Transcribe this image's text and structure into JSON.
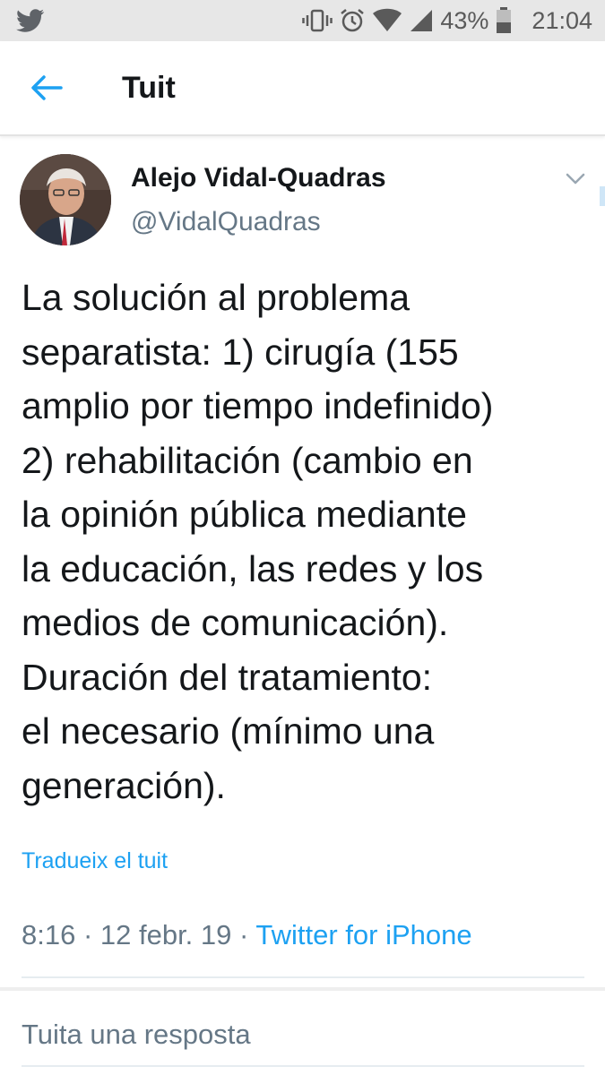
{
  "status_bar": {
    "battery_percent": "43%",
    "time": "21:04",
    "icons": [
      "twitter-bird-icon",
      "vibrate-icon",
      "alarm-icon",
      "wifi-icon",
      "cell-signal-icon",
      "battery-icon"
    ]
  },
  "app_bar": {
    "title": "Tuit",
    "back_icon": "arrow-left-icon"
  },
  "tweet": {
    "author_name": "Alejo Vidal-Quadras",
    "author_handle": "@VidalQuadras",
    "text_lines": [
      "La solución al problema",
      "separatista: 1) cirugía (155",
      "amplio por tiempo indefinido)",
      "2) rehabilitación (cambio en",
      "la opinión pública mediante",
      "la educación, las redes y los",
      "medios de comunicación).",
      "Duración del tratamiento:",
      "el necesario (mínimo una",
      "generación)."
    ],
    "translate_label": "Tradueix el tuit",
    "timestamp": "8:16 · 12 febr. 19 · ",
    "source": "Twitter for iPhone"
  },
  "reply": {
    "placeholder": "Tuita una resposta"
  },
  "colors": {
    "accent": "#1da1f2",
    "text": "#14171a",
    "secondary": "#657786",
    "status_bar_bg": "#e7e7e7"
  }
}
